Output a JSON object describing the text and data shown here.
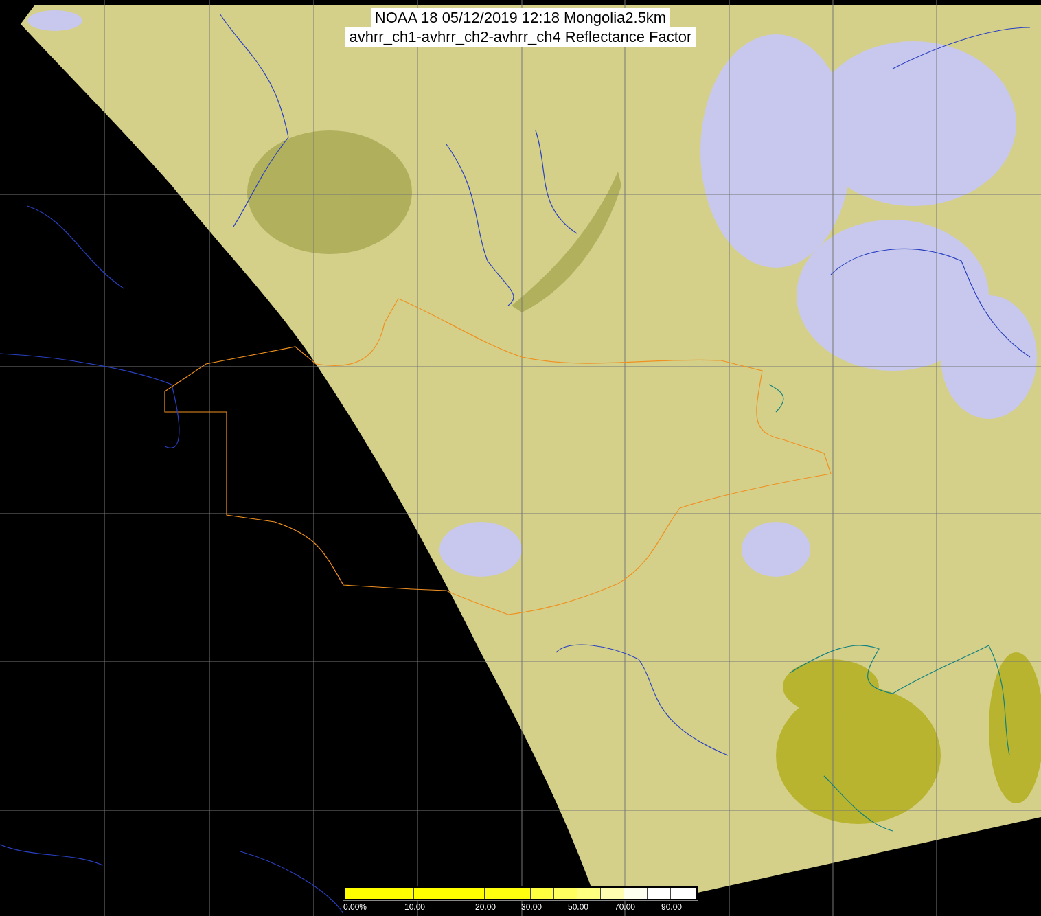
{
  "title": {
    "lines": [
      "NOAA 18 05/12/2019 12:18 Mongolia2.5km",
      "avhrr_ch1-avhrr_ch2-avhrr_ch4 Reflectance Factor"
    ]
  },
  "color_bar": {
    "segments": [
      {
        "color": "#ffff00"
      },
      {
        "color": "#ffff00"
      },
      {
        "color": "#ffff10"
      },
      {
        "color": "#ffff40"
      },
      {
        "color": "#ffff60"
      },
      {
        "color": "#ffff80"
      },
      {
        "color": "#fffdb0"
      },
      {
        "color": "#fffff0"
      },
      {
        "color": "#ffffff"
      },
      {
        "color": "#ffffff"
      }
    ],
    "labels": [
      "0.00%",
      "10.00",
      "20.00",
      "30.00",
      "50.00",
      "70.00",
      "90.00"
    ]
  }
}
